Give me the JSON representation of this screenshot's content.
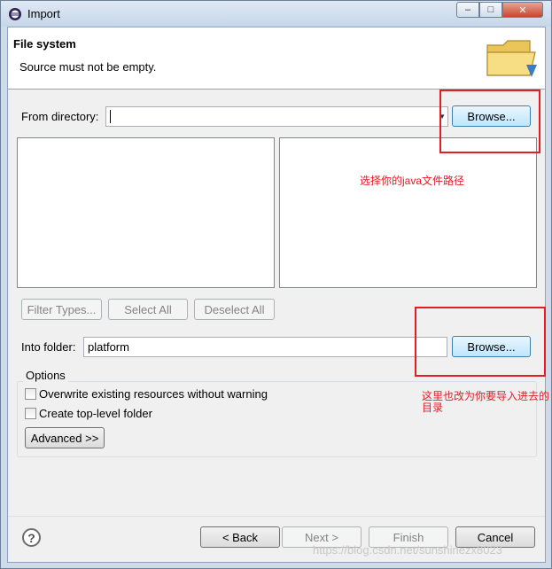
{
  "window": {
    "title": "Import",
    "minimize_glyph": "–",
    "maximize_glyph": "□",
    "close_glyph": "✕"
  },
  "header": {
    "title": "File system",
    "message": "Source must not be empty."
  },
  "source": {
    "from_directory_label": "From directory:",
    "directory_value": "",
    "browse_label": "Browse..."
  },
  "selection_buttons": {
    "filter_types": "Filter Types...",
    "select_all": "Select All",
    "deselect_all": "Deselect All"
  },
  "destination": {
    "into_folder_label": "Into folder:",
    "folder_value": "platform",
    "browse_label": "Browse..."
  },
  "options": {
    "group_label": "Options",
    "overwrite_label": "Overwrite existing resources without warning",
    "overwrite_checked": false,
    "create_top_level_label": "Create top-level folder",
    "create_top_level_checked": false,
    "advanced_label": "Advanced >>"
  },
  "annotations": {
    "browse_note": "选择你的java文件路径",
    "folder_note_line1": "这里也改为你要导入进去的",
    "folder_note_line2": "目录",
    "color": "#e51c23"
  },
  "footer": {
    "help_glyph": "?",
    "back_label": "< Back",
    "next_label": "Next >",
    "finish_label": "Finish",
    "cancel_label": "Cancel"
  },
  "watermark": "https://blog.csdn.net/sunshinezx8023"
}
